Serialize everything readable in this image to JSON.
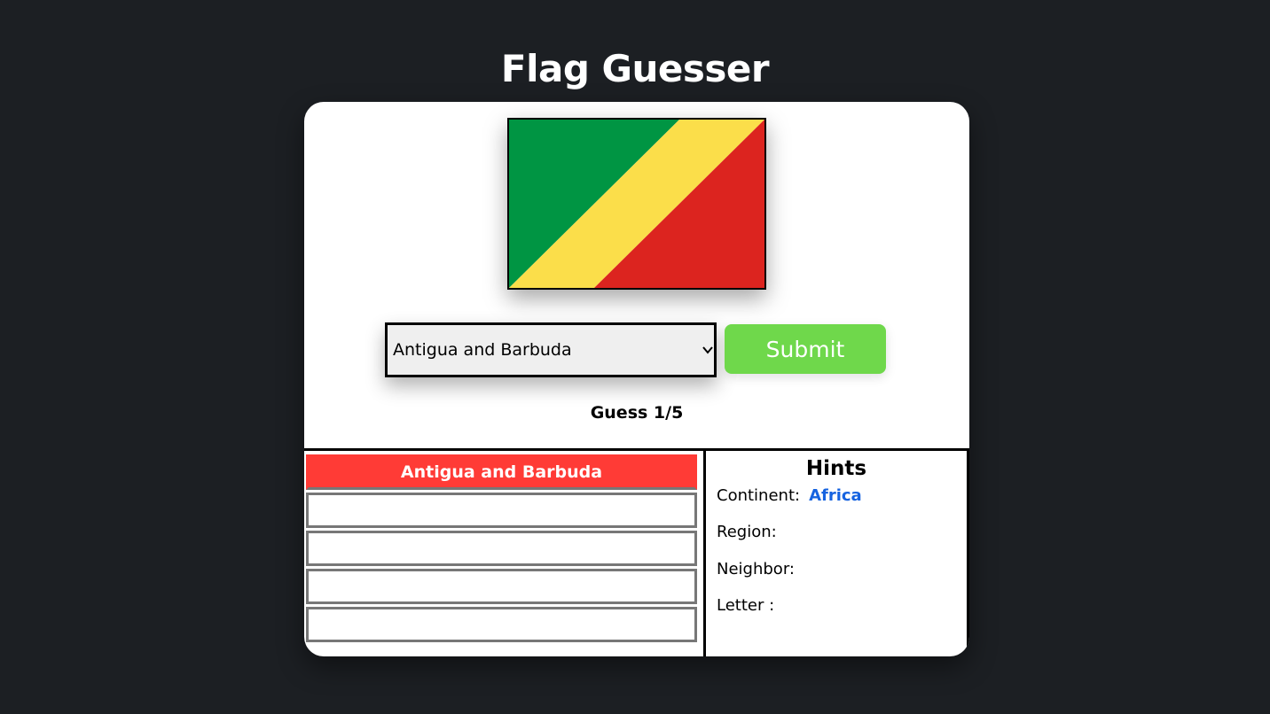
{
  "app": {
    "title": "Flag Guesser"
  },
  "flag": {
    "icon": "flag-of-republic-of-the-congo",
    "colors": {
      "green": "#009543",
      "yellow": "#fbde4a",
      "red": "#dc241f"
    }
  },
  "guess_form": {
    "selected_country": "Antigua and Barbuda",
    "submit_label": "Submit"
  },
  "status": {
    "guess_counter": "Guess 1/5"
  },
  "guesses": [
    {
      "text": "Antigua and Barbuda",
      "state": "wrong"
    },
    {
      "text": "",
      "state": "empty"
    },
    {
      "text": "",
      "state": "empty"
    },
    {
      "text": "",
      "state": "empty"
    },
    {
      "text": "",
      "state": "empty"
    }
  ],
  "hints": {
    "title": "Hints",
    "continent_label": "Continent:",
    "continent_value": "Africa",
    "region_label": "Region:",
    "neighbor_label": "Neighbor:",
    "letter_label": "Letter :"
  },
  "colors": {
    "background": "#1c1f23",
    "submit": "#6fd84b",
    "wrong_guess": "#ff3b36",
    "hint_value": "#1663e0"
  }
}
